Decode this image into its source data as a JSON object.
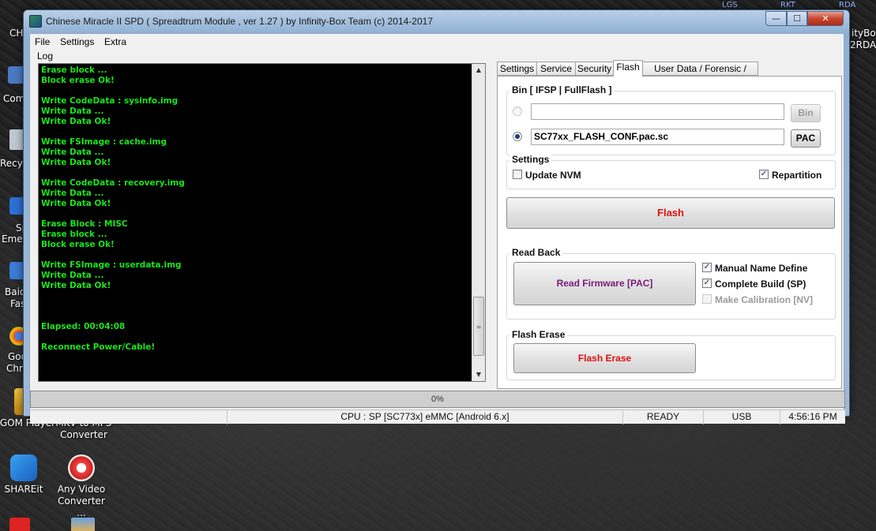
{
  "window": {
    "title": "Chinese Miracle II SPD ( Spreadtrum Module , ver 1.27 ) by Infinity-Box Team (c) 2014-2017",
    "min_glyph": "—",
    "max_glyph": "☐",
    "close_glyph": "✕"
  },
  "menu": [
    "File",
    "Settings",
    "Extra"
  ],
  "log": {
    "label": "Log",
    "lines": [
      "Erase block ...",
      "Block erase Ok!",
      "",
      "Write CodeData : sysinfo.img",
      "Write Data ...",
      "Write Data Ok!",
      "",
      "Write FSImage : cache.img",
      "Write Data ...",
      "Write Data Ok!",
      "",
      "Write CodeData : recovery.img",
      "Write Data ...",
      "Write Data Ok!",
      "",
      "Erase Block : MISC",
      "Erase block ...",
      "Block erase Ok!",
      "",
      "Write FSImage : userdata.img",
      "Write Data ...",
      "Write Data Ok!",
      "",
      "",
      "",
      "Elapsed: 00:04:08",
      "",
      "Reconnect Power/Cable!"
    ],
    "text_color": "#19e619"
  },
  "tabs": [
    {
      "label": "Settings",
      "active": false
    },
    {
      "label": "Service",
      "active": false
    },
    {
      "label": "Security",
      "active": false
    },
    {
      "label": "Flash",
      "active": true
    },
    {
      "label": "User Data / Forensic / Other",
      "active": false
    }
  ],
  "bin_group": {
    "title": "Bin  [ IFSP | FullFlash ]",
    "bin_path": "",
    "bin_button": "Bin",
    "pac_path": "SC77xx_FLASH_CONF.pac.sc",
    "pac_button": "PAC"
  },
  "settings_group": {
    "title": "Settings",
    "update_nvm": {
      "label": "Update NVM",
      "checked": false
    },
    "repartition": {
      "label": "Repartition",
      "checked": true
    }
  },
  "flash_button": {
    "label": "Flash",
    "color": "#e01010"
  },
  "read_back": {
    "title": "Read Back",
    "button": "Read Firmware [PAC]",
    "button_color": "#7a1a7a",
    "manual_name": {
      "label": "Manual Name Define",
      "checked": true
    },
    "complete_build": {
      "label": "Complete Build (SP)",
      "checked": true
    },
    "make_calibration": {
      "label": "Make Calibration [NV]",
      "checked": false,
      "enabled": false
    }
  },
  "flash_erase": {
    "title": "Flash Erase",
    "button": "Flash Erase",
    "button_color": "#e01010"
  },
  "progress": {
    "text": "0%",
    "value": 0
  },
  "status": {
    "cpu": "CPU : SP [SC773x] eMMC [Android 6.x]",
    "state": "READY",
    "port": "USB",
    "time": "4:56:16 PM"
  },
  "desktop": {
    "icons": [
      {
        "label": "SHAREit"
      },
      {
        "label": "Any Video Converter ..."
      },
      {
        "label": "GOM Player"
      },
      {
        "label": "MKV to MP3 Converter"
      }
    ],
    "left_fragments": [
      "CH",
      "Com",
      "Recyc",
      "Sp",
      "Emer",
      "Baid",
      "Fas",
      "Goo",
      "Chr"
    ],
    "right_fragments": [
      "ityBox",
      "2RDA"
    ],
    "tray": [
      "LGS",
      "RKT",
      "RDA"
    ]
  }
}
